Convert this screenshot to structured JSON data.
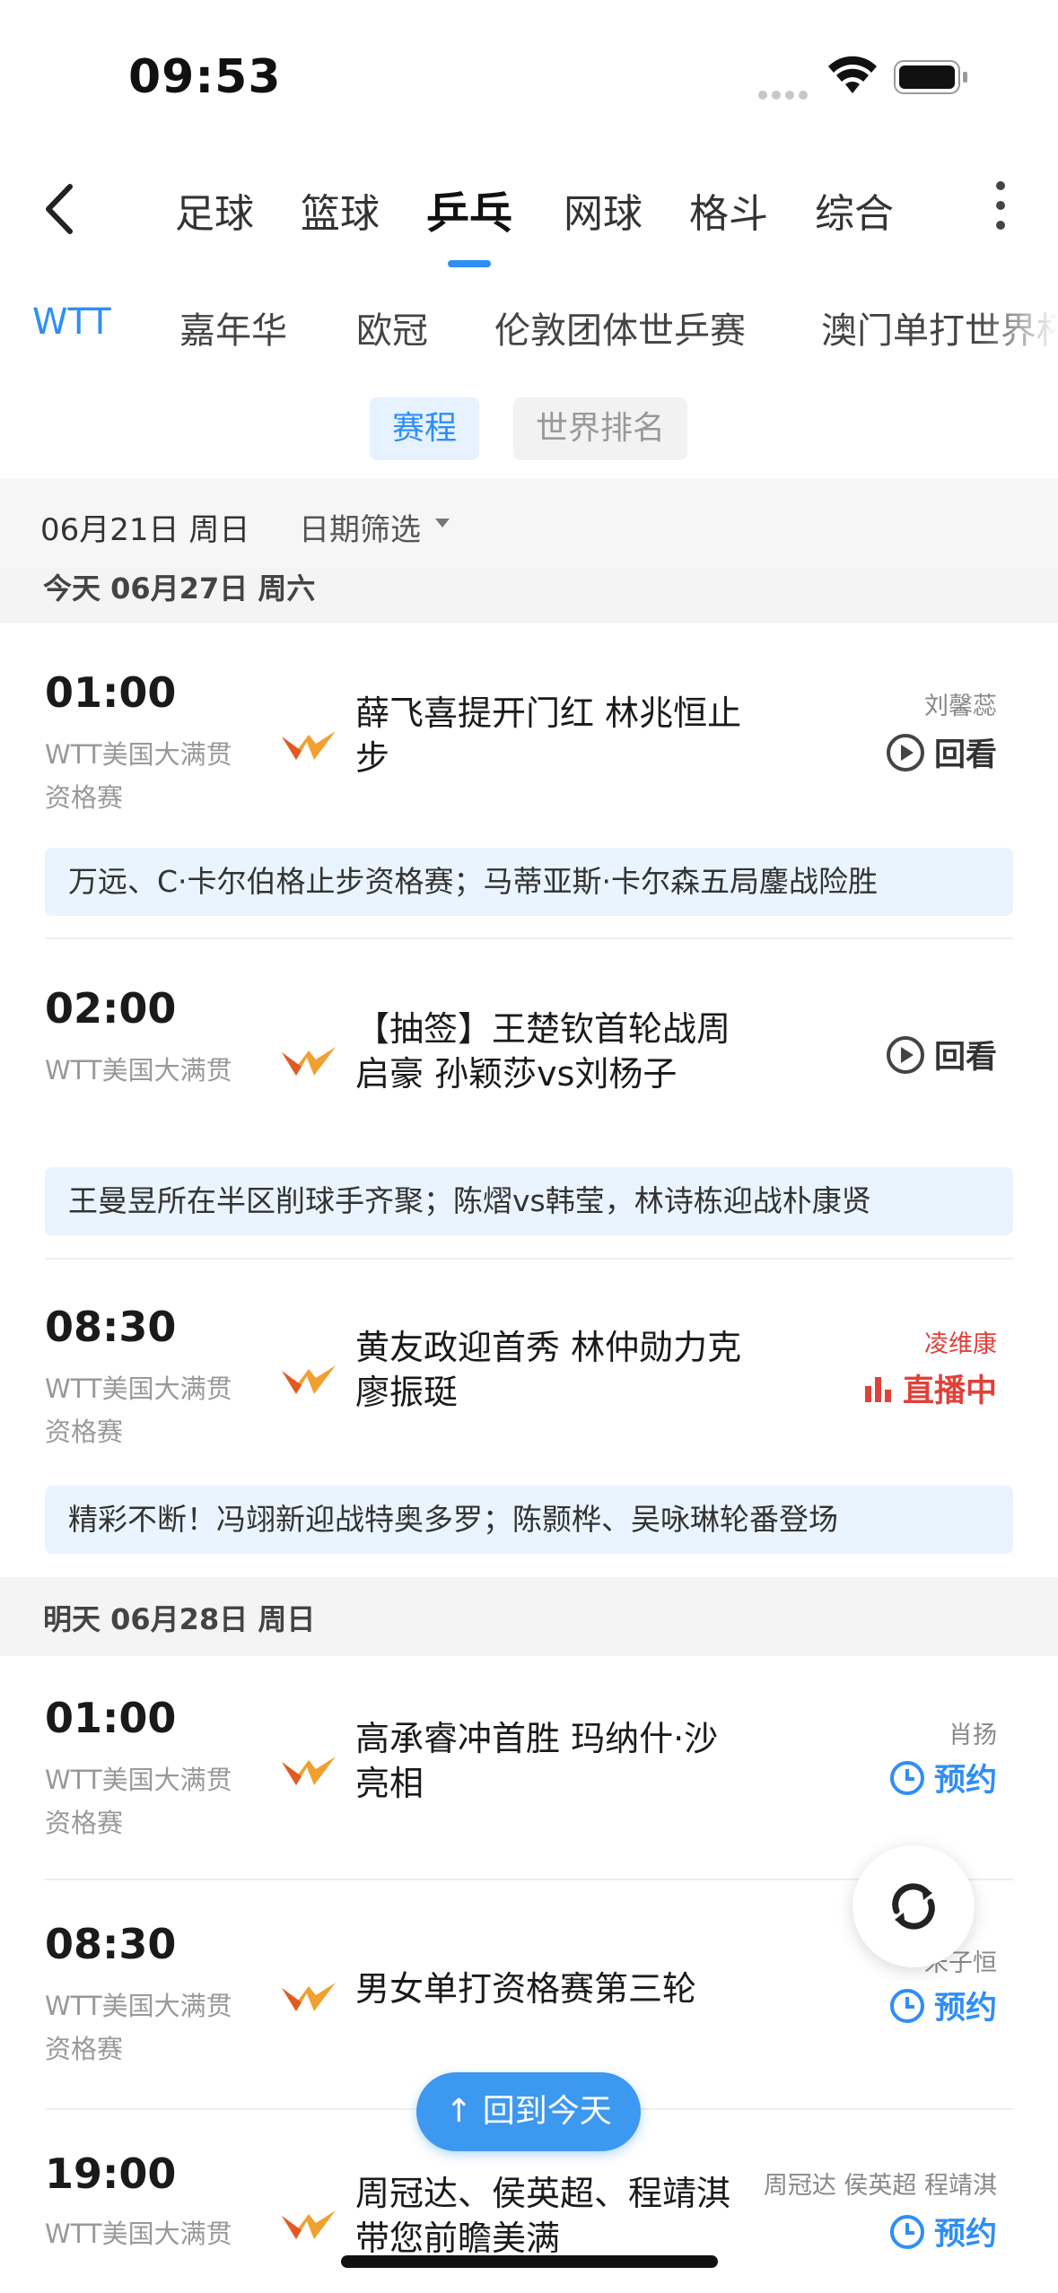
{
  "status_bar": {
    "time": "09:53"
  },
  "sport_tabs": [
    {
      "label": "足球"
    },
    {
      "label": "篮球"
    },
    {
      "label": "乒乓"
    },
    {
      "label": "网球"
    },
    {
      "label": "格斗"
    },
    {
      "label": "综合"
    }
  ],
  "league_tabs": [
    {
      "label": "WTT"
    },
    {
      "label": "嘉年华"
    },
    {
      "label": "欧冠"
    },
    {
      "label": "伦敦团体世乒赛"
    },
    {
      "label": "澳门单打世界杯"
    }
  ],
  "segment": {
    "schedule": "赛程",
    "ranking": "世界排名"
  },
  "date_bar": {
    "current": "06月21日  周日",
    "filter": "日期筛选"
  },
  "day_headers": {
    "today": "今天  06月27日  周六",
    "tomorrow": "明天  06月28日  周日"
  },
  "matches": [
    {
      "time": "01:00",
      "league": "WTT美国大满贯资格赛",
      "title": "薛飞喜提开门红 林兆恒止步",
      "anchor": "刘馨蕊",
      "action": "回看",
      "note": "万远、C·卡尔伯格止步资格赛；马蒂亚斯·卡尔森五局鏖战险胜"
    },
    {
      "time": "02:00",
      "league": "WTT美国大满贯",
      "title": "【抽签】王楚钦首轮战周启豪 孙颖莎vs刘杨子",
      "anchor": "",
      "action": "回看",
      "note": "王曼昱所在半区削球手齐聚；陈熠vs韩莹，林诗栋迎战朴康贤"
    },
    {
      "time": "08:30",
      "league": "WTT美国大满贯资格赛",
      "title": "黄友政迎首秀 林仲勋力克廖振珽",
      "anchor": "凌维康",
      "action": "直播中",
      "note": "精彩不断！冯翊新迎战特奥多罗；陈颢桦、吴咏琳轮番登场"
    },
    {
      "time": "01:00",
      "league": "WTT美国大满贯资格赛",
      "title": "高承睿冲首胜 玛纳什·沙亮相",
      "anchor": "肖扬",
      "action": "预约"
    },
    {
      "time": "08:30",
      "league": "WTT美国大满贯资格赛",
      "title": "男女单打资格赛第三轮",
      "anchor": "宋子恒",
      "action": "预约"
    },
    {
      "time": "19:00",
      "league": "WTT美国大满贯",
      "title": "周冠达、侯英超、程靖淇带您前瞻美满",
      "anchor": "周冠达 侯英超 程靖淇",
      "action": "预约"
    }
  ],
  "floating": {
    "back_to_today": "↑ 回到今天"
  },
  "colors": {
    "accent": "#2f8ef5",
    "live": "#e0413a",
    "note_bg": "#eaf4ff"
  }
}
